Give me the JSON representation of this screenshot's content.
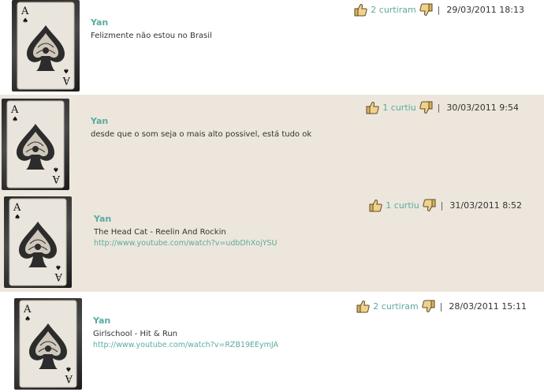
{
  "colors": {
    "accent": "#5bab9f",
    "shaded_row": "#ede6dc",
    "text": "#333333"
  },
  "icons": {
    "like": "thumbs-up-icon",
    "dislike": "thumbs-down-icon",
    "avatar": "ace-of-spades-card"
  },
  "comments": [
    {
      "author": "Yan",
      "likes": "2 curtiram",
      "date": "29/03/2011 18:13",
      "text": "Felizmente não estou no Brasil",
      "link": ""
    },
    {
      "author": "Yan",
      "likes": "1 curtiu",
      "date": "30/03/2011 9:54",
      "text": "desde que o som seja o mais alto possivel, está tudo ok",
      "link": ""
    },
    {
      "author": "Yan",
      "likes": "1 curtiu",
      "date": "31/03/2011 8:52",
      "text": "The Head Cat - Reelin And Rockin",
      "link": "http://www.youtube.com/watch?v=udbDhXojYSU"
    },
    {
      "author": "Yan",
      "likes": "2 curtiram",
      "date": "28/03/2011 15:11",
      "text": "Girlschool - Hit & Run",
      "link": "http://www.youtube.com/watch?v=RZB19EEymJA"
    }
  ]
}
